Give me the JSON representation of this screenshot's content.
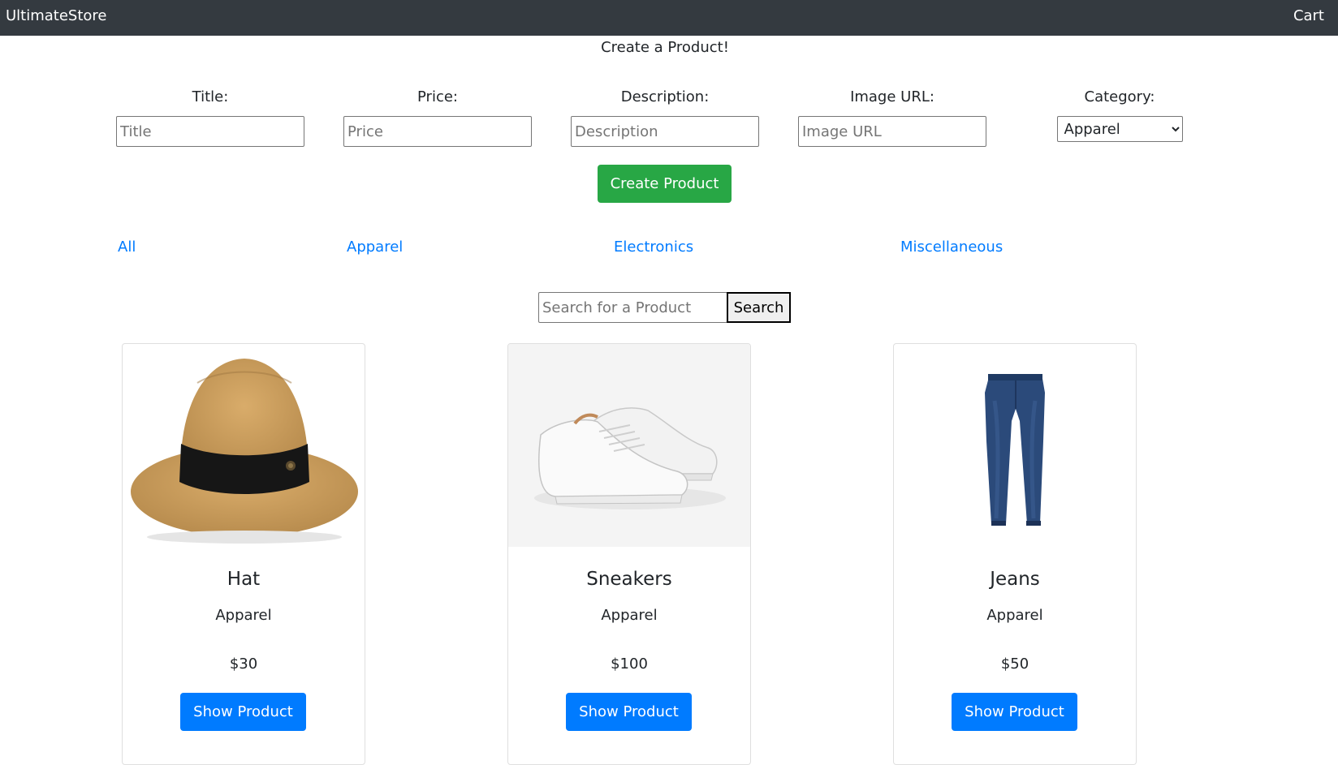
{
  "navbar": {
    "brand": "UltimateStore",
    "cart": "Cart"
  },
  "form": {
    "heading": "Create a Product!",
    "title_label": "Title:",
    "title_placeholder": "Title",
    "price_label": "Price:",
    "price_placeholder": "Price",
    "description_label": "Description:",
    "description_placeholder": "Description",
    "image_label": "Image URL:",
    "image_placeholder": "Image URL",
    "category_label": "Category:",
    "category_selected": "Apparel",
    "submit_label": "Create Product"
  },
  "categories": [
    "All",
    "Apparel",
    "Electronics",
    "Miscellaneous"
  ],
  "search": {
    "placeholder": "Search for a Product",
    "button_label": "Search"
  },
  "products": [
    {
      "title": "Hat",
      "category": "Apparel",
      "price": "$30",
      "button": "Show Product",
      "image": "hat-image"
    },
    {
      "title": "Sneakers",
      "category": "Apparel",
      "price": "$100",
      "button": "Show Product",
      "image": "sneakers-image"
    },
    {
      "title": "Jeans",
      "category": "Apparel",
      "price": "$50",
      "button": "Show Product",
      "image": "jeans-image"
    }
  ],
  "colors": {
    "navbar": "#343a40",
    "create_button": "#28a745",
    "primary": "#007bff",
    "link": "#007bff"
  }
}
